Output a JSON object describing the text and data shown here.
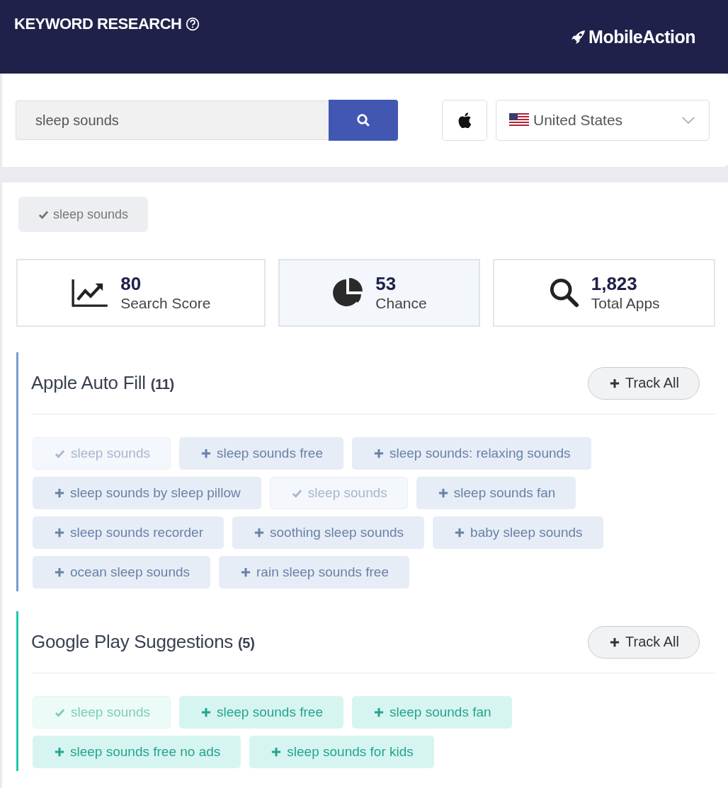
{
  "header": {
    "title": "KEYWORD RESEARCH",
    "logo": "MobileAction"
  },
  "search": {
    "value": "sleep sounds",
    "country": "United States"
  },
  "selected_keywords": [
    {
      "label": "sleep sounds",
      "checked": true
    }
  ],
  "stats": [
    {
      "kind": "trend",
      "value": "80",
      "label": "Search Score",
      "selected": false
    },
    {
      "kind": "pie",
      "value": "53",
      "label": "Chance",
      "selected": true
    },
    {
      "kind": "search",
      "value": "1,823",
      "label": "Total Apps",
      "selected": false
    }
  ],
  "sections": [
    {
      "title": "Apple Auto Fill",
      "count": "(11)",
      "color": "#7b9bcf",
      "button": "Track All",
      "keywords": [
        {
          "label": "sleep sounds",
          "tracked": true
        },
        {
          "label": "sleep sounds free",
          "tracked": false
        },
        {
          "label": "sleep sounds: relaxing sounds",
          "tracked": false
        },
        {
          "label": "sleep sounds by sleep pillow",
          "tracked": false
        },
        {
          "label": "sleep sounds",
          "tracked": true
        },
        {
          "label": "sleep sounds fan",
          "tracked": false
        },
        {
          "label": "sleep sounds recorder",
          "tracked": false
        },
        {
          "label": "soothing sleep sounds",
          "tracked": false
        },
        {
          "label": "baby sleep sounds",
          "tracked": false
        },
        {
          "label": "ocean sleep sounds",
          "tracked": false
        },
        {
          "label": "rain sleep sounds free",
          "tracked": false
        }
      ]
    },
    {
      "title": "Google Play Suggestions",
      "count": "(5)",
      "color": "#1ec9ad",
      "button": "Track All",
      "keywords": [
        {
          "label": "sleep sounds",
          "tracked": true
        },
        {
          "label": "sleep sounds free",
          "tracked": false
        },
        {
          "label": "sleep sounds fan",
          "tracked": false
        },
        {
          "label": "sleep sounds free no ads",
          "tracked": false
        },
        {
          "label": "sleep sounds for kids",
          "tracked": false
        }
      ]
    }
  ]
}
